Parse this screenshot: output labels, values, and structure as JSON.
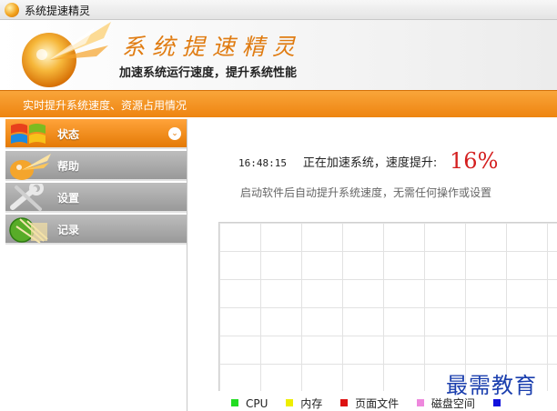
{
  "window": {
    "title": "系统提速精灵",
    "icon": "app-logo-icon"
  },
  "banner": {
    "title": "系统提速精灵",
    "subtitle": "加速系统运行速度，提升系统性能"
  },
  "info_bar": {
    "text": "实时提升系统速度、资源占用情况"
  },
  "sidebar": {
    "items": [
      {
        "label": "状态",
        "icon": "windows-flag-icon",
        "active": true
      },
      {
        "label": "帮助",
        "icon": "speed-sparkle-icon",
        "active": false
      },
      {
        "label": "设置",
        "icon": "wrench-icon",
        "active": false
      },
      {
        "label": "记录",
        "icon": "record-globe-icon",
        "active": false
      }
    ]
  },
  "status": {
    "time": "16:48:15",
    "text": "正在加速系统，速度提升:",
    "percent": "16%",
    "hint": "启动软件后自动提升系统速度，无需任何操作或设置"
  },
  "legend": [
    {
      "label": "CPU",
      "color": "#22dd22"
    },
    {
      "label": "内存",
      "color": "#eeee00"
    },
    {
      "label": "页面文件",
      "color": "#dd1111"
    },
    {
      "label": "磁盘空间",
      "color": "#ee88dd"
    },
    {
      "label": "",
      "color": "#1111dd"
    }
  ],
  "watermark": "最需教育",
  "colors": {
    "accent": "#ee8410",
    "percent": "#d41f1f",
    "watermark": "#1b3fae"
  }
}
